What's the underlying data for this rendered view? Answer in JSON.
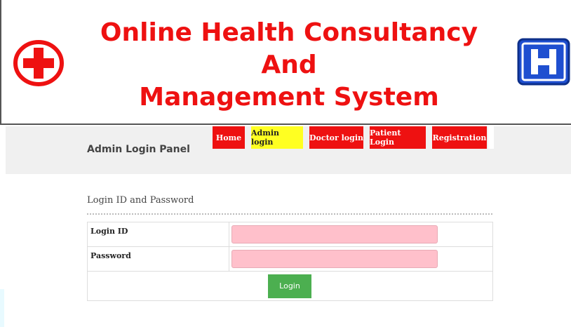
{
  "header": {
    "title_line1": "Online Health Consultancy And",
    "title_line2": "Management System",
    "logo_left_icon": "red-cross-icon",
    "logo_right_icon": "hospital-h-icon"
  },
  "nav": {
    "items": [
      {
        "label": "Home",
        "bg": "#ee1111",
        "color": "#ffffff"
      },
      {
        "label": "Admin login",
        "bg": "#ffff22",
        "color": "#222222",
        "active": true
      },
      {
        "label": "Doctor login",
        "bg": "#ee1111",
        "color": "#ffffff"
      },
      {
        "label": "Patient Login",
        "bg": "#ee1111",
        "color": "#ffffff"
      },
      {
        "label": "Registration",
        "bg": "#ee1111",
        "color": "#ffffff"
      }
    ]
  },
  "panel": {
    "title": "Admin Login Panel"
  },
  "form": {
    "heading": "Login ID and Password",
    "login_id_label": "Login ID",
    "login_id_value": "",
    "password_label": "Password",
    "password_value": "",
    "submit_label": "Login",
    "field_color": "#ffc0cb",
    "button_color": "#4caf50"
  }
}
